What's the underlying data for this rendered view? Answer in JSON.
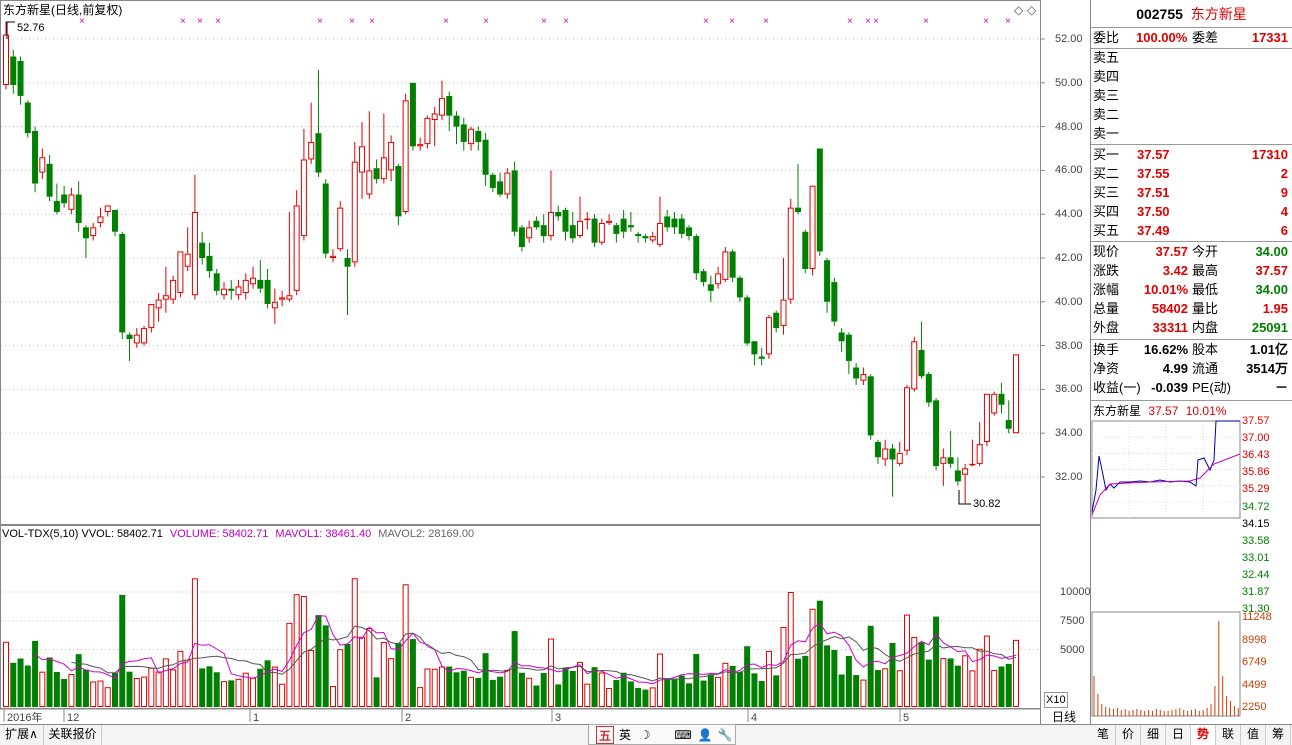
{
  "chart": {
    "title": "东方新星(日线,前复权)",
    "high_marker": "52.76",
    "low_marker": "30.82",
    "y_ticks": [
      "52.00",
      "50.00",
      "48.00",
      "46.00",
      "44.00",
      "42.00",
      "40.00",
      "38.00",
      "36.00",
      "34.00",
      "32.00"
    ],
    "vol_ticks": [
      "10000",
      "7500",
      "5000"
    ],
    "vol_multiplier": "X10",
    "period_label": "日线",
    "x_labels": [
      "2016年",
      "12",
      "1",
      "2",
      "3",
      "4",
      "5"
    ],
    "colors": {
      "up": "#e00000",
      "down": "#008000",
      "ma1": "#d000d0",
      "ma2": "#555555",
      "grid": "#c0c0c0"
    }
  },
  "vol_header": {
    "name": "VOL-TDX(5,10)",
    "vvol": "VVOL: 58402.71",
    "volume": "VOLUME: 58402.71",
    "mavol1": "MAVOL1: 38461.40",
    "mavol2": "MAVOL2: 28169.00"
  },
  "chart_data": {
    "type": "candlestick",
    "title": "东方新星(日线,前复权)",
    "candles": [
      {
        "o": 49.9,
        "c": 52.2,
        "h": 52.8,
        "l": 49.7
      },
      {
        "o": 51.2,
        "c": 49.9,
        "h": 51.5,
        "l": 49.5
      },
      {
        "o": 51.0,
        "c": 49.4,
        "h": 51.2,
        "l": 49.0
      },
      {
        "o": 49.1,
        "c": 47.7,
        "h": 49.2,
        "l": 47.5
      },
      {
        "o": 47.8,
        "c": 45.4,
        "h": 48.0,
        "l": 45.0
      },
      {
        "o": 45.9,
        "c": 46.6,
        "h": 47.0,
        "l": 45.6
      },
      {
        "o": 46.3,
        "c": 44.8,
        "h": 46.7,
        "l": 44.6
      },
      {
        "o": 44.6,
        "c": 44.1,
        "h": 45.4,
        "l": 44.0
      },
      {
        "o": 44.9,
        "c": 44.5,
        "h": 45.3,
        "l": 44.3
      },
      {
        "o": 44.2,
        "c": 44.9,
        "h": 45.2,
        "l": 44.0
      },
      {
        "o": 44.9,
        "c": 43.6,
        "h": 45.5,
        "l": 43.2
      },
      {
        "o": 43.4,
        "c": 42.9,
        "h": 43.5,
        "l": 42.0
      },
      {
        "o": 43.0,
        "c": 43.4,
        "h": 43.6,
        "l": 42.8
      },
      {
        "o": 43.6,
        "c": 43.9,
        "h": 44.3,
        "l": 43.4
      },
      {
        "o": 44.1,
        "c": 44.4,
        "h": 44.4,
        "l": 43.9
      },
      {
        "o": 44.2,
        "c": 43.2,
        "h": 44.2,
        "l": 43.0
      },
      {
        "o": 43.1,
        "c": 38.6,
        "h": 43.2,
        "l": 38.3
      },
      {
        "o": 38.5,
        "c": 38.3,
        "h": 38.6,
        "l": 37.3
      },
      {
        "o": 38.1,
        "c": 38.5,
        "h": 38.8,
        "l": 37.9
      },
      {
        "o": 38.1,
        "c": 38.8,
        "h": 38.9,
        "l": 38.0
      },
      {
        "o": 38.8,
        "c": 39.9,
        "h": 39.9,
        "l": 38.6
      },
      {
        "o": 39.7,
        "c": 40.1,
        "h": 40.4,
        "l": 39.1
      },
      {
        "o": 40.1,
        "c": 40.3,
        "h": 41.6,
        "l": 39.5
      },
      {
        "o": 40.1,
        "c": 41.0,
        "h": 41.2,
        "l": 39.9
      },
      {
        "o": 40.4,
        "c": 42.3,
        "h": 42.3,
        "l": 40.2
      },
      {
        "o": 41.6,
        "c": 42.2,
        "h": 43.4,
        "l": 41.4
      },
      {
        "o": 40.3,
        "c": 44.1,
        "h": 45.8,
        "l": 40.1
      },
      {
        "o": 42.7,
        "c": 42.0,
        "h": 43.2,
        "l": 41.7
      },
      {
        "o": 42.1,
        "c": 41.4,
        "h": 42.7,
        "l": 41.1
      },
      {
        "o": 41.3,
        "c": 40.5,
        "h": 41.5,
        "l": 40.3
      },
      {
        "o": 40.3,
        "c": 40.6,
        "h": 40.9,
        "l": 40.1
      },
      {
        "o": 40.6,
        "c": 40.5,
        "h": 41.0,
        "l": 40.1
      },
      {
        "o": 40.3,
        "c": 40.7,
        "h": 41.0,
        "l": 40.1
      },
      {
        "o": 40.4,
        "c": 41.0,
        "h": 41.3,
        "l": 40.1
      },
      {
        "o": 40.8,
        "c": 41.1,
        "h": 41.6,
        "l": 40.6
      },
      {
        "o": 41.0,
        "c": 40.6,
        "h": 41.9,
        "l": 40.4
      },
      {
        "o": 41.0,
        "c": 39.9,
        "h": 41.5,
        "l": 39.7
      },
      {
        "o": 39.7,
        "c": 40.0,
        "h": 40.6,
        "l": 39.0
      },
      {
        "o": 40.1,
        "c": 40.2,
        "h": 40.5,
        "l": 39.8
      },
      {
        "o": 40.1,
        "c": 40.3,
        "h": 44.1,
        "l": 40.0
      },
      {
        "o": 40.5,
        "c": 44.4,
        "h": 45.1,
        "l": 40.3
      },
      {
        "o": 43.0,
        "c": 46.5,
        "h": 47.9,
        "l": 42.8
      },
      {
        "o": 46.5,
        "c": 47.3,
        "h": 49.1,
        "l": 46.3
      },
      {
        "o": 47.7,
        "c": 45.9,
        "h": 50.6,
        "l": 45.7
      },
      {
        "o": 45.4,
        "c": 42.2,
        "h": 45.6,
        "l": 42.0
      },
      {
        "o": 42.0,
        "c": 42.1,
        "h": 42.4,
        "l": 41.8
      },
      {
        "o": 42.4,
        "c": 44.3,
        "h": 44.6,
        "l": 42.3
      },
      {
        "o": 42.0,
        "c": 41.6,
        "h": 42.4,
        "l": 39.4
      },
      {
        "o": 41.8,
        "c": 46.4,
        "h": 47.3,
        "l": 41.6
      },
      {
        "o": 45.9,
        "c": 47.1,
        "h": 48.2,
        "l": 44.7
      },
      {
        "o": 44.9,
        "c": 46.0,
        "h": 48.7,
        "l": 44.7
      },
      {
        "o": 46.1,
        "c": 45.6,
        "h": 46.5,
        "l": 45.4
      },
      {
        "o": 45.6,
        "c": 46.6,
        "h": 48.6,
        "l": 45.4
      },
      {
        "o": 46.0,
        "c": 47.3,
        "h": 47.6,
        "l": 45.5
      },
      {
        "o": 46.2,
        "c": 43.9,
        "h": 46.3,
        "l": 43.5
      },
      {
        "o": 44.1,
        "c": 49.2,
        "h": 49.5,
        "l": 44.0
      },
      {
        "o": 50.0,
        "c": 47.1,
        "h": 50.0,
        "l": 46.9
      },
      {
        "o": 47.1,
        "c": 47.2,
        "h": 47.5,
        "l": 46.9
      },
      {
        "o": 47.2,
        "c": 48.4,
        "h": 48.5,
        "l": 47.0
      },
      {
        "o": 48.3,
        "c": 48.6,
        "h": 48.9,
        "l": 47.1
      },
      {
        "o": 48.5,
        "c": 49.3,
        "h": 50.1,
        "l": 48.3
      },
      {
        "o": 49.4,
        "c": 48.5,
        "h": 49.6,
        "l": 47.8
      },
      {
        "o": 48.5,
        "c": 48.0,
        "h": 48.7,
        "l": 47.2
      },
      {
        "o": 48.1,
        "c": 47.3,
        "h": 48.4,
        "l": 46.9
      },
      {
        "o": 47.2,
        "c": 47.9,
        "h": 48.0,
        "l": 46.9
      },
      {
        "o": 47.8,
        "c": 47.3,
        "h": 48.0,
        "l": 46.9
      },
      {
        "o": 47.4,
        "c": 45.8,
        "h": 47.7,
        "l": 45.3
      },
      {
        "o": 45.8,
        "c": 45.2,
        "h": 45.9,
        "l": 45.0
      },
      {
        "o": 45.5,
        "c": 44.9,
        "h": 45.9,
        "l": 44.8
      },
      {
        "o": 44.9,
        "c": 45.9,
        "h": 46.1,
        "l": 44.7
      },
      {
        "o": 46.0,
        "c": 43.2,
        "h": 46.4,
        "l": 43.0
      },
      {
        "o": 43.4,
        "c": 42.5,
        "h": 43.5,
        "l": 42.3
      },
      {
        "o": 42.9,
        "c": 43.4,
        "h": 43.7,
        "l": 42.7
      },
      {
        "o": 43.7,
        "c": 43.4,
        "h": 43.9,
        "l": 43.3
      },
      {
        "o": 43.5,
        "c": 43.0,
        "h": 44.0,
        "l": 42.7
      },
      {
        "o": 43.0,
        "c": 44.1,
        "h": 46.0,
        "l": 42.8
      },
      {
        "o": 44.1,
        "c": 43.9,
        "h": 44.4,
        "l": 43.7
      },
      {
        "o": 44.2,
        "c": 43.2,
        "h": 44.3,
        "l": 42.8
      },
      {
        "o": 43.5,
        "c": 42.9,
        "h": 44.1,
        "l": 42.7
      },
      {
        "o": 43.0,
        "c": 43.7,
        "h": 44.8,
        "l": 42.9
      },
      {
        "o": 43.8,
        "c": 43.8,
        "h": 44.1,
        "l": 43.3
      },
      {
        "o": 43.8,
        "c": 42.7,
        "h": 44.0,
        "l": 42.5
      },
      {
        "o": 42.7,
        "c": 43.6,
        "h": 43.8,
        "l": 42.6
      },
      {
        "o": 43.6,
        "c": 43.7,
        "h": 44.0,
        "l": 43.5
      },
      {
        "o": 43.5,
        "c": 43.1,
        "h": 43.6,
        "l": 42.7
      },
      {
        "o": 43.8,
        "c": 43.2,
        "h": 44.2,
        "l": 42.9
      },
      {
        "o": 43.5,
        "c": 43.4,
        "h": 44.1,
        "l": 43.2
      },
      {
        "o": 43.1,
        "c": 43.0,
        "h": 43.2,
        "l": 42.7
      },
      {
        "o": 43.0,
        "c": 42.9,
        "h": 43.1,
        "l": 42.7
      },
      {
        "o": 42.8,
        "c": 43.0,
        "h": 43.2,
        "l": 42.7
      },
      {
        "o": 42.6,
        "c": 43.6,
        "h": 44.8,
        "l": 42.5
      },
      {
        "o": 43.9,
        "c": 43.4,
        "h": 44.2,
        "l": 43.2
      },
      {
        "o": 43.8,
        "c": 43.4,
        "h": 44.1,
        "l": 43.1
      },
      {
        "o": 43.8,
        "c": 43.1,
        "h": 44.0,
        "l": 42.9
      },
      {
        "o": 43.4,
        "c": 43.0,
        "h": 43.5,
        "l": 42.8
      },
      {
        "o": 43.0,
        "c": 41.3,
        "h": 43.1,
        "l": 41.0
      },
      {
        "o": 41.4,
        "c": 40.9,
        "h": 41.5,
        "l": 40.7
      },
      {
        "o": 40.8,
        "c": 40.5,
        "h": 41.2,
        "l": 40.0
      },
      {
        "o": 40.8,
        "c": 41.3,
        "h": 41.6,
        "l": 40.6
      },
      {
        "o": 41.0,
        "c": 42.3,
        "h": 42.5,
        "l": 40.9
      },
      {
        "o": 42.3,
        "c": 41.1,
        "h": 42.4,
        "l": 40.9
      },
      {
        "o": 41.1,
        "c": 40.2,
        "h": 41.2,
        "l": 40.0
      },
      {
        "o": 40.2,
        "c": 38.1,
        "h": 40.3,
        "l": 38.0
      },
      {
        "o": 38.2,
        "c": 37.6,
        "h": 38.2,
        "l": 37.1
      },
      {
        "o": 37.5,
        "c": 37.4,
        "h": 37.9,
        "l": 37.1
      },
      {
        "o": 37.6,
        "c": 39.3,
        "h": 39.4,
        "l": 37.4
      },
      {
        "o": 39.5,
        "c": 38.8,
        "h": 39.6,
        "l": 38.6
      },
      {
        "o": 38.9,
        "c": 40.1,
        "h": 42.0,
        "l": 38.5
      },
      {
        "o": 40.1,
        "c": 44.3,
        "h": 44.7,
        "l": 39.9
      },
      {
        "o": 44.3,
        "c": 44.1,
        "h": 46.3,
        "l": 44.0
      },
      {
        "o": 43.2,
        "c": 41.5,
        "h": 43.3,
        "l": 41.3
      },
      {
        "o": 41.5,
        "c": 45.3,
        "h": 45.3,
        "l": 41.2
      },
      {
        "o": 47.0,
        "c": 42.3,
        "h": 47.0,
        "l": 42.1
      },
      {
        "o": 41.9,
        "c": 40.0,
        "h": 42.0,
        "l": 39.5
      },
      {
        "o": 40.9,
        "c": 39.1,
        "h": 41.1,
        "l": 38.9
      },
      {
        "o": 38.6,
        "c": 38.2,
        "h": 38.8,
        "l": 37.7
      },
      {
        "o": 38.5,
        "c": 37.3,
        "h": 38.6,
        "l": 36.7
      },
      {
        "o": 37.0,
        "c": 36.5,
        "h": 37.2,
        "l": 36.2
      },
      {
        "o": 36.4,
        "c": 36.7,
        "h": 37.0,
        "l": 36.2
      },
      {
        "o": 36.6,
        "c": 33.9,
        "h": 36.7,
        "l": 33.7
      },
      {
        "o": 33.6,
        "c": 32.9,
        "h": 33.7,
        "l": 32.6
      },
      {
        "o": 32.8,
        "c": 33.3,
        "h": 33.7,
        "l": 32.5
      },
      {
        "o": 33.3,
        "c": 32.8,
        "h": 33.5,
        "l": 31.1
      },
      {
        "o": 32.6,
        "c": 33.1,
        "h": 33.6,
        "l": 32.5
      },
      {
        "o": 33.2,
        "c": 36.1,
        "h": 36.2,
        "l": 33.0
      },
      {
        "o": 36.0,
        "c": 38.2,
        "h": 38.4,
        "l": 35.9
      },
      {
        "o": 37.8,
        "c": 36.6,
        "h": 39.1,
        "l": 36.5
      },
      {
        "o": 36.7,
        "c": 35.4,
        "h": 36.8,
        "l": 35.2
      },
      {
        "o": 35.5,
        "c": 32.5,
        "h": 35.6,
        "l": 32.3
      },
      {
        "o": 32.6,
        "c": 32.9,
        "h": 33.3,
        "l": 31.6
      },
      {
        "o": 32.9,
        "c": 32.6,
        "h": 34.1,
        "l": 32.4
      },
      {
        "o": 32.3,
        "c": 31.8,
        "h": 32.9,
        "l": 31.6
      },
      {
        "o": 32.1,
        "c": 32.4,
        "h": 32.6,
        "l": 30.8
      },
      {
        "o": 32.6,
        "c": 32.6,
        "h": 33.7,
        "l": 32.5
      },
      {
        "o": 32.6,
        "c": 33.5,
        "h": 34.5,
        "l": 32.5
      },
      {
        "o": 33.6,
        "c": 35.8,
        "h": 35.8,
        "l": 33.4
      },
      {
        "o": 34.9,
        "c": 35.8,
        "h": 35.9,
        "l": 34.8
      },
      {
        "o": 35.8,
        "c": 35.3,
        "h": 36.3,
        "l": 34.9
      },
      {
        "o": 34.6,
        "c": 34.2,
        "h": 35.5,
        "l": 34.0
      },
      {
        "o": 34.0,
        "c": 37.6,
        "h": 37.6,
        "l": 34.0
      }
    ],
    "volume_scale": "X10",
    "y_range": [
      30.5,
      53.5
    ]
  },
  "quote": {
    "code": "002755",
    "name": "东方新星",
    "weibi_label": "委比",
    "weibi_value": "100.00%",
    "weicha_label": "委差",
    "weicha_value": "17331",
    "sells": [
      {
        "label": "卖五",
        "price": "",
        "vol": ""
      },
      {
        "label": "卖四",
        "price": "",
        "vol": ""
      },
      {
        "label": "卖三",
        "price": "",
        "vol": ""
      },
      {
        "label": "卖二",
        "price": "",
        "vol": ""
      },
      {
        "label": "卖一",
        "price": "",
        "vol": ""
      }
    ],
    "buys": [
      {
        "label": "买一",
        "price": "37.57",
        "vol": "17310"
      },
      {
        "label": "买二",
        "price": "37.55",
        "vol": "2"
      },
      {
        "label": "买三",
        "price": "37.51",
        "vol": "9"
      },
      {
        "label": "买四",
        "price": "37.50",
        "vol": "4"
      },
      {
        "label": "买五",
        "price": "37.49",
        "vol": "6"
      }
    ],
    "stats": [
      {
        "l1": "现价",
        "v1": "37.57",
        "c1": "red",
        "l2": "今开",
        "v2": "34.00",
        "c2": "green"
      },
      {
        "l1": "涨跌",
        "v1": "3.42",
        "c1": "red",
        "l2": "最高",
        "v2": "37.57",
        "c2": "red"
      },
      {
        "l1": "涨幅",
        "v1": "10.01%",
        "c1": "red",
        "l2": "最低",
        "v2": "34.00",
        "c2": "green"
      },
      {
        "l1": "总量",
        "v1": "58402",
        "c1": "red",
        "l2": "量比",
        "v2": "1.95",
        "c2": "red"
      },
      {
        "l1": "外盘",
        "v1": "33311",
        "c1": "red",
        "l2": "内盘",
        "v2": "25091",
        "c2": "green"
      }
    ],
    "stats2": [
      {
        "l1": "换手",
        "v1": "16.62%",
        "l2": "股本",
        "v2": "1.01亿"
      },
      {
        "l1": "净资",
        "v1": "4.99",
        "l2": "流通",
        "v2": "3514万"
      },
      {
        "l1": "收益(一)",
        "v1": "-0.039",
        "l2": "PE(动)",
        "v2": "－"
      }
    ]
  },
  "mini": {
    "name": "东方新星",
    "price": "37.57",
    "pct": "10.01%",
    "price_ticks": [
      "37.57",
      "37.00",
      "36.43",
      "35.86",
      "35.29",
      "34.72",
      "34.15",
      "33.58",
      "33.01",
      "32.44",
      "31.87",
      "31.30"
    ],
    "vol_ticks": [
      "11248",
      "8998",
      "6749",
      "4499",
      "2250"
    ]
  },
  "bottom": {
    "left_tabs": [
      "扩展∧",
      "关联报价"
    ],
    "right_tabs": [
      "笔",
      "价",
      "细",
      "日",
      "势",
      "联",
      "值",
      "筹"
    ],
    "active_right": "势",
    "tool_icons": [
      "五",
      "英",
      "☽",
      "⌨",
      "👤",
      "🔧"
    ]
  }
}
